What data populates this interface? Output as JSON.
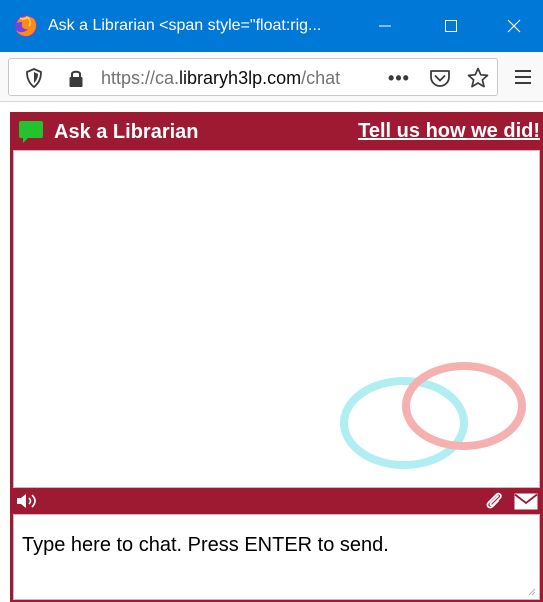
{
  "window": {
    "title": "Ask a Librarian <span style=\"float:rig...",
    "controls": [
      "minimize",
      "maximize",
      "close"
    ]
  },
  "browser": {
    "url_prefix": "https://ca.",
    "url_domain": "libraryh3lp.com",
    "url_rest": "/chat",
    "more_label": "•••",
    "icons": [
      "tracking-shield-icon",
      "lock-icon",
      "pocket-icon",
      "bookmark-star-icon",
      "hamburger-menu-icon"
    ]
  },
  "chat": {
    "title": "Ask a Librarian",
    "feedback_link": "Tell us how we did!",
    "input_placeholder": "Type here to chat. Press ENTER to send.",
    "icons": [
      "chat-bubble-icon",
      "speaker-icon",
      "paperclip-icon",
      "envelope-icon"
    ]
  },
  "colors": {
    "titlebar": "#0078d7",
    "chat_brand": "#9e1932",
    "bubble_green": "#22c32e",
    "watermark_red": "#f5b0b0",
    "watermark_cyan": "#b0eef2"
  }
}
